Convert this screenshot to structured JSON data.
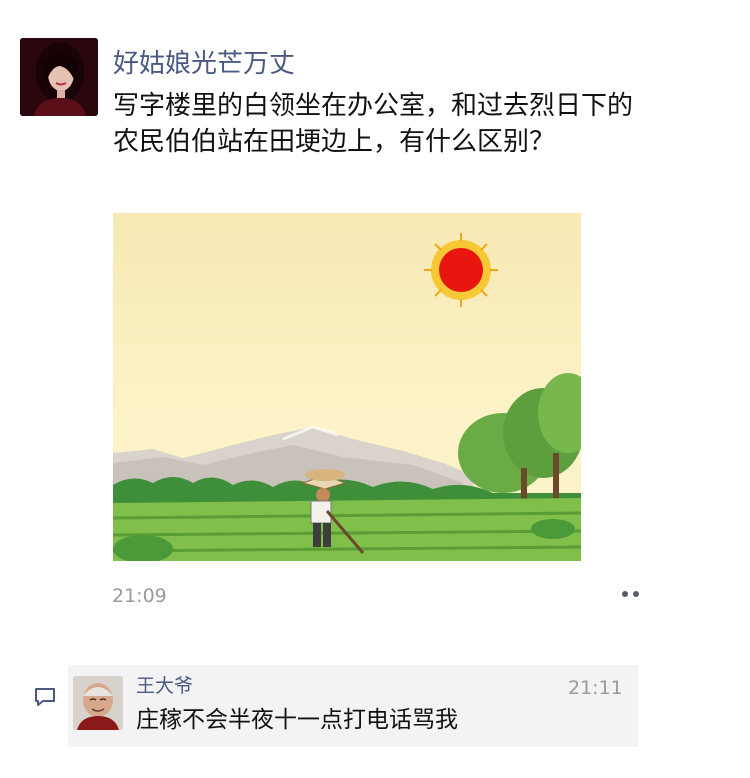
{
  "post": {
    "author": "好姑娘光芒万丈",
    "text": "写字楼里的白领坐在办公室，和过去烈日下的农民伯伯站在田埂边上，有什么区别？",
    "time": "21:09",
    "image_icon": "farmer-under-sun-illustration",
    "more_icon": "more-dots-icon"
  },
  "comment": {
    "icon": "comment-bubble-icon",
    "author": "王大爷",
    "time": "21:11",
    "text": "庄稼不会半夜十一点打电话骂我"
  },
  "colors": {
    "name_blue": "#4a5a82",
    "time_gray": "#9a9a9a",
    "comment_bg": "#f3f3f5",
    "sun_red": "#e8160f"
  }
}
